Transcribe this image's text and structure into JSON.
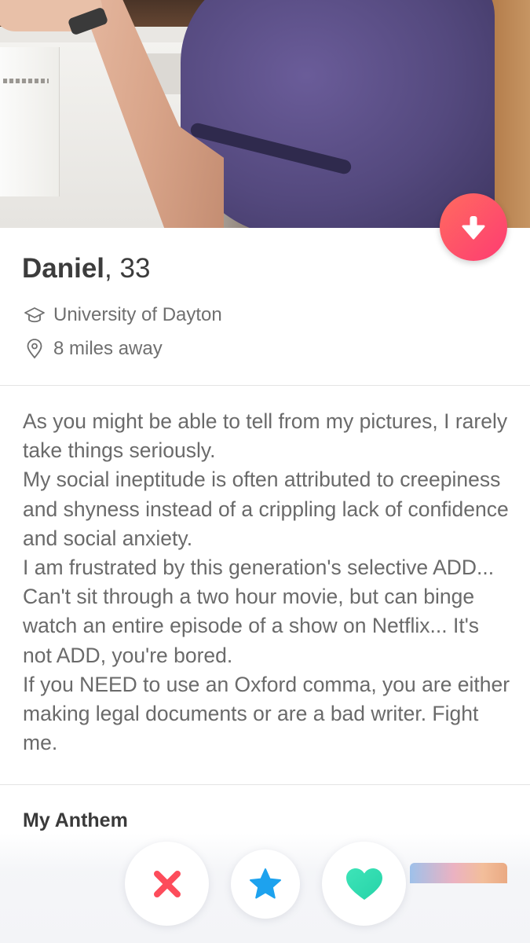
{
  "profile": {
    "name": "Daniel",
    "age_text": ", 33",
    "school": "University of Dayton",
    "distance": "8 miles away"
  },
  "bio": {
    "lines": [
      "As you might be able to tell from my pictures, I rarely take things seriously.",
      "My social ineptitude is often attributed to creepiness and shyness instead of a crippling lack of confidence and social anxiety.",
      "I am frustrated by this generation's selective ADD... Can't sit through a two hour movie, but can binge watch an entire episode of a show on Netflix... It's not ADD, you're bored.",
      "If you NEED to use an Oxford comma, you are either making legal documents or are a bad writer. Fight me."
    ]
  },
  "anthem": {
    "title": "My Anthem"
  },
  "icons": {
    "collapse": "arrow-down-icon",
    "school": "graduation-cap-icon",
    "distance": "location-pin-icon",
    "nope": "x-icon",
    "super_like": "star-icon",
    "like": "heart-icon"
  },
  "colors": {
    "brand_gradient_start": "#ff6b5f",
    "brand_gradient_end": "#fe3c72",
    "nope": "#fd4c5b",
    "super_like": "#1da2ee",
    "like": "#2fdcb2"
  }
}
